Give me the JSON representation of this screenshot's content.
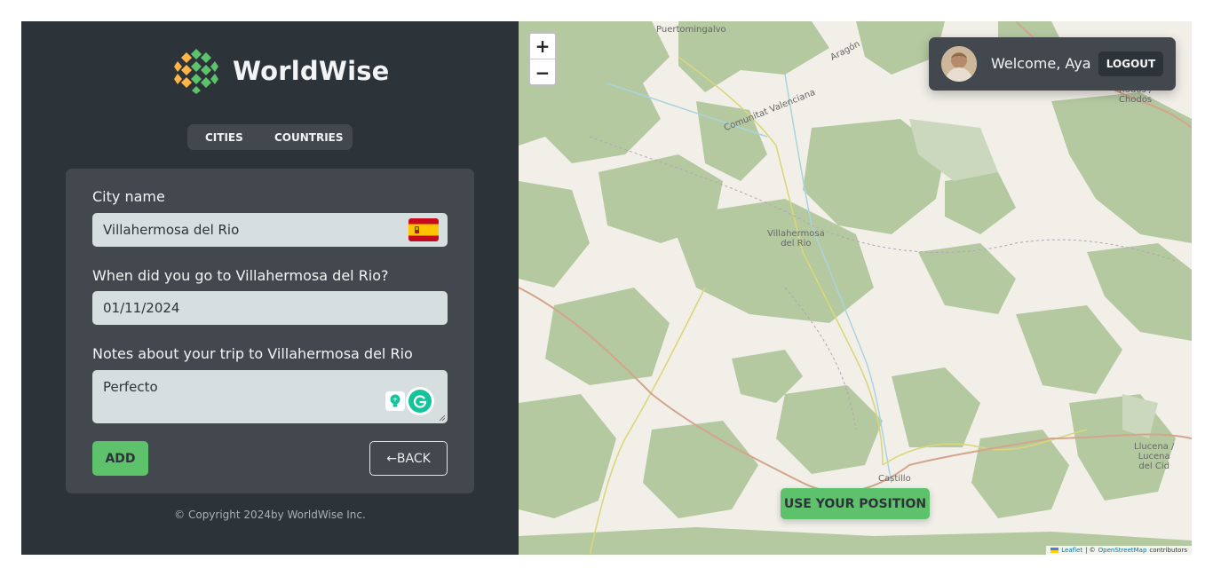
{
  "app": {
    "brand": "WorldWise",
    "copyright": "© Copyright 2024by WorldWise Inc."
  },
  "nav": {
    "tabs": [
      {
        "label": "CITIES"
      },
      {
        "label": "COUNTRIES"
      }
    ]
  },
  "form": {
    "city_label": "City name",
    "city_value": "Villahermosa del Rio",
    "flag_icon": "spain-flag-icon",
    "date_label": "When did you go to Villahermosa del Rio?",
    "date_value": "01/11/2024",
    "notes_label": "Notes about your trip to Villahermosa del Rio",
    "notes_value": "Perfecto",
    "add_label": "ADD",
    "back_label": "←BACK"
  },
  "map": {
    "zoom_in": "+",
    "zoom_out": "−",
    "use_position": "USE YOUR POSITION",
    "places": {
      "puertomingalvo": "Puertomingalvo",
      "aragon": "Aragón",
      "comunitat": "Comunitat Valenciana",
      "villahermosa_1": "Villahermosa",
      "villahermosa_2": "del Rio",
      "xodos_1": "Xodos /",
      "xodos_2": "Chodos",
      "castillo": "Castillo",
      "llucena_1": "Llucena /",
      "llucena_2": "Lucena",
      "llucena_3": "del Cid"
    },
    "attribution": {
      "leaflet": "Leaflet",
      "separator": "| ©",
      "osm": "OpenStreetMap",
      "contributors": "contributors"
    }
  },
  "user": {
    "welcome": "Welcome, Aya",
    "logout": "LOGOUT"
  },
  "colors": {
    "sidebar_bg": "#2d3439",
    "panel_bg": "#42484d",
    "brand_green": "#5ec16c",
    "field_bg": "#d6dee0",
    "map_forest": "#b4c9a0",
    "map_land": "#f2efe9"
  }
}
